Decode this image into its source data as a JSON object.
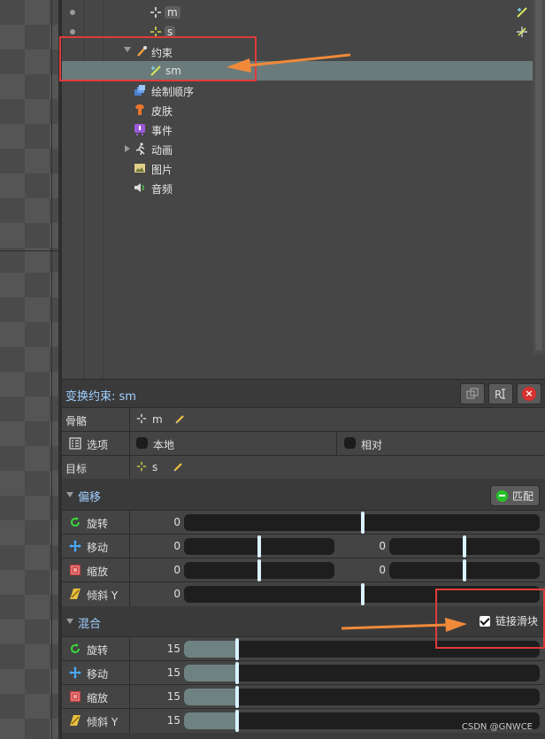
{
  "colors": {
    "accent_text": "#9fd0ff",
    "selected_row": "#6b7b7b",
    "annotation_red": "#e03a3a",
    "annotation_arrow": "#f08a3a"
  },
  "tree": {
    "items": [
      {
        "label": "m",
        "icon": "bone-icon"
      },
      {
        "label": "s",
        "icon": "bone-icon"
      },
      {
        "label": "约束",
        "icon": "constraint-icon"
      },
      {
        "label": "sm",
        "icon": "transform-constraint-icon"
      },
      {
        "label": "绘制顺序",
        "icon": "draw-order-icon"
      },
      {
        "label": "皮肤",
        "icon": "skin-icon"
      },
      {
        "label": "事件",
        "icon": "event-icon"
      },
      {
        "label": "动画",
        "icon": "animation-icon"
      },
      {
        "label": "图片",
        "icon": "image-icon"
      },
      {
        "label": "音频",
        "icon": "audio-icon"
      }
    ]
  },
  "panel": {
    "title": "变换约束: sm",
    "bone_label": "骨骼",
    "bone_value": "m",
    "options_label": "选项",
    "local_label": "本地",
    "relative_label": "相对",
    "target_label": "目标",
    "target_value": "s"
  },
  "offset": {
    "title": "偏移",
    "match_button": "匹配",
    "rows": [
      {
        "label": "旋转",
        "values": [
          "0"
        ],
        "icon": "rotate-icon"
      },
      {
        "label": "移动",
        "values": [
          "0",
          "0"
        ],
        "icon": "translate-icon"
      },
      {
        "label": "缩放",
        "values": [
          "0",
          "0"
        ],
        "icon": "scale-icon"
      },
      {
        "label": "倾斜 Y",
        "values": [
          "0"
        ],
        "icon": "shear-icon"
      }
    ]
  },
  "mix": {
    "title": "混合",
    "link_sliders_label": "链接滑块",
    "link_sliders_checked": true,
    "rows": [
      {
        "label": "旋转",
        "value": "15",
        "fraction": 0.15,
        "icon": "rotate-icon"
      },
      {
        "label": "移动",
        "value": "15",
        "fraction": 0.15,
        "icon": "translate-icon"
      },
      {
        "label": "缩放",
        "value": "15",
        "fraction": 0.15,
        "icon": "scale-icon"
      },
      {
        "label": "倾斜 Y",
        "value": "15",
        "fraction": 0.15,
        "icon": "shear-icon"
      }
    ]
  },
  "watermark": "CSDN @GNWCE"
}
